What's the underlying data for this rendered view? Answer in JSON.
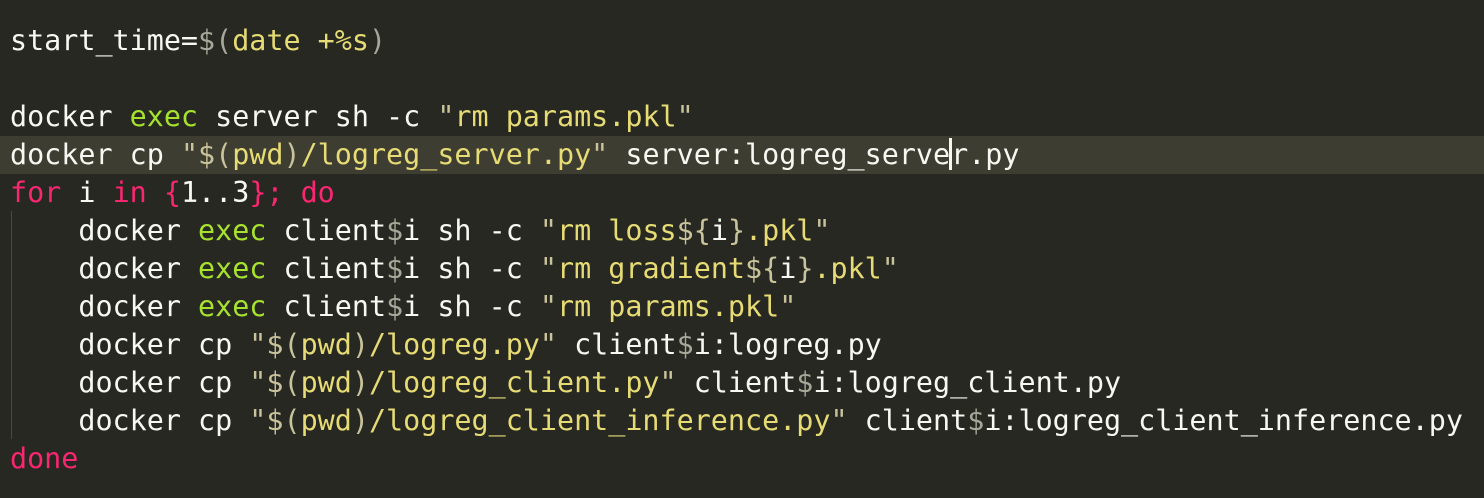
{
  "editor": {
    "lines": [
      {
        "tokens": [
          {
            "t": "start_time=",
            "c": "plain"
          },
          {
            "t": "$(",
            "c": "sym"
          },
          {
            "t": "date +%s",
            "c": "str"
          },
          {
            "t": ")",
            "c": "sym"
          }
        ]
      },
      {
        "tokens": []
      },
      {
        "tokens": [
          {
            "t": "docker ",
            "c": "plain"
          },
          {
            "t": "exec",
            "c": "builtin"
          },
          {
            "t": " server sh -c ",
            "c": "plain"
          },
          {
            "t": "\"",
            "c": "quote"
          },
          {
            "t": "rm params.pkl",
            "c": "str"
          },
          {
            "t": "\"",
            "c": "quote"
          }
        ]
      },
      {
        "current": true,
        "tokens": [
          {
            "t": "docker cp ",
            "c": "plain"
          },
          {
            "t": "\"$(",
            "c": "quote"
          },
          {
            "t": "pwd",
            "c": "str"
          },
          {
            "t": ")",
            "c": "quote"
          },
          {
            "t": "/logreg_server.py",
            "c": "str"
          },
          {
            "t": "\"",
            "c": "quote"
          },
          {
            "t": " server:logreg_serve",
            "c": "plain"
          },
          {
            "t": "",
            "c": "caret"
          },
          {
            "t": "r.py",
            "c": "plain"
          }
        ]
      },
      {
        "tokens": [
          {
            "t": "for",
            "c": "kw"
          },
          {
            "t": " i ",
            "c": "plain"
          },
          {
            "t": "in",
            "c": "kw"
          },
          {
            "t": " ",
            "c": "plain"
          },
          {
            "t": "{",
            "c": "brace"
          },
          {
            "t": "1..3",
            "c": "num"
          },
          {
            "t": "}",
            "c": "brace"
          },
          {
            "t": "; ",
            "c": "kw"
          },
          {
            "t": "do",
            "c": "kw"
          }
        ]
      },
      {
        "tokens": [
          {
            "t": "    docker ",
            "c": "plain"
          },
          {
            "t": "exec",
            "c": "builtin"
          },
          {
            "t": " client",
            "c": "plain"
          },
          {
            "t": "$",
            "c": "sym"
          },
          {
            "t": "i sh -c ",
            "c": "plain"
          },
          {
            "t": "\"",
            "c": "quote"
          },
          {
            "t": "rm loss",
            "c": "str"
          },
          {
            "t": "${",
            "c": "quote"
          },
          {
            "t": "i",
            "c": "plain"
          },
          {
            "t": "}",
            "c": "quote"
          },
          {
            "t": ".pkl",
            "c": "str"
          },
          {
            "t": "\"",
            "c": "quote"
          }
        ]
      },
      {
        "tokens": [
          {
            "t": "    docker ",
            "c": "plain"
          },
          {
            "t": "exec",
            "c": "builtin"
          },
          {
            "t": " client",
            "c": "plain"
          },
          {
            "t": "$",
            "c": "sym"
          },
          {
            "t": "i sh -c ",
            "c": "plain"
          },
          {
            "t": "\"",
            "c": "quote"
          },
          {
            "t": "rm gradient",
            "c": "str"
          },
          {
            "t": "${",
            "c": "quote"
          },
          {
            "t": "i",
            "c": "plain"
          },
          {
            "t": "}",
            "c": "quote"
          },
          {
            "t": ".pkl",
            "c": "str"
          },
          {
            "t": "\"",
            "c": "quote"
          }
        ]
      },
      {
        "tokens": [
          {
            "t": "    docker ",
            "c": "plain"
          },
          {
            "t": "exec",
            "c": "builtin"
          },
          {
            "t": " client",
            "c": "plain"
          },
          {
            "t": "$",
            "c": "sym"
          },
          {
            "t": "i sh -c ",
            "c": "plain"
          },
          {
            "t": "\"",
            "c": "quote"
          },
          {
            "t": "rm params.pkl",
            "c": "str"
          },
          {
            "t": "\"",
            "c": "quote"
          }
        ]
      },
      {
        "tokens": [
          {
            "t": "    docker cp ",
            "c": "plain"
          },
          {
            "t": "\"$(",
            "c": "quote"
          },
          {
            "t": "pwd",
            "c": "str"
          },
          {
            "t": ")",
            "c": "quote"
          },
          {
            "t": "/logreg.py",
            "c": "str"
          },
          {
            "t": "\"",
            "c": "quote"
          },
          {
            "t": " client",
            "c": "plain"
          },
          {
            "t": "$",
            "c": "sym"
          },
          {
            "t": "i:logreg.py",
            "c": "plain"
          }
        ]
      },
      {
        "tokens": [
          {
            "t": "    docker cp ",
            "c": "plain"
          },
          {
            "t": "\"$(",
            "c": "quote"
          },
          {
            "t": "pwd",
            "c": "str"
          },
          {
            "t": ")",
            "c": "quote"
          },
          {
            "t": "/logreg_client.py",
            "c": "str"
          },
          {
            "t": "\"",
            "c": "quote"
          },
          {
            "t": " client",
            "c": "plain"
          },
          {
            "t": "$",
            "c": "sym"
          },
          {
            "t": "i:logreg_client.py",
            "c": "plain"
          }
        ]
      },
      {
        "tokens": [
          {
            "t": "    docker cp ",
            "c": "plain"
          },
          {
            "t": "\"$(",
            "c": "quote"
          },
          {
            "t": "pwd",
            "c": "str"
          },
          {
            "t": ")",
            "c": "quote"
          },
          {
            "t": "/logreg_client_inference.py",
            "c": "str"
          },
          {
            "t": "\"",
            "c": "quote"
          },
          {
            "t": " client",
            "c": "plain"
          },
          {
            "t": "$",
            "c": "sym"
          },
          {
            "t": "i:logreg_client_inference.py",
            "c": "plain"
          }
        ]
      },
      {
        "tokens": [
          {
            "t": "done",
            "c": "kw"
          }
        ]
      }
    ]
  }
}
